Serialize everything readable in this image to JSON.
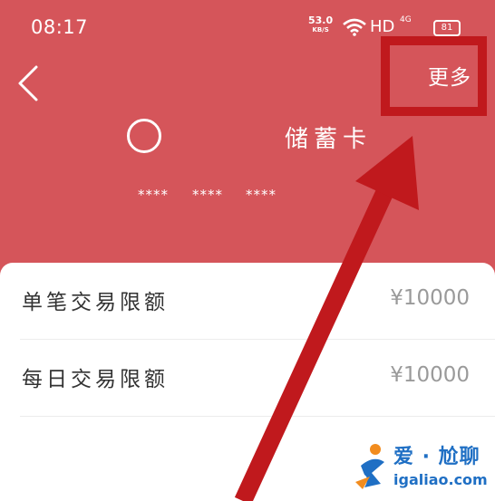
{
  "status_bar": {
    "time": "08:17",
    "net_speed": "53.0",
    "net_speed_unit": "KB/S",
    "hd": "HD",
    "network": "4G",
    "battery": "81"
  },
  "header": {
    "more_label": "更多",
    "card_type": "储蓄卡",
    "card_number_groups": [
      "****",
      "****",
      "****"
    ]
  },
  "limits": [
    {
      "label": "单笔交易限额",
      "value": "¥10000"
    },
    {
      "label": "每日交易限额",
      "value": "¥10000"
    }
  ],
  "watermark": {
    "brand": "爱 · 尬聊",
    "url": "igaliao.com"
  },
  "colors": {
    "header_bg": "#d5555a",
    "annotation_red": "#c0191d",
    "watermark_blue": "#1f6fc4"
  }
}
